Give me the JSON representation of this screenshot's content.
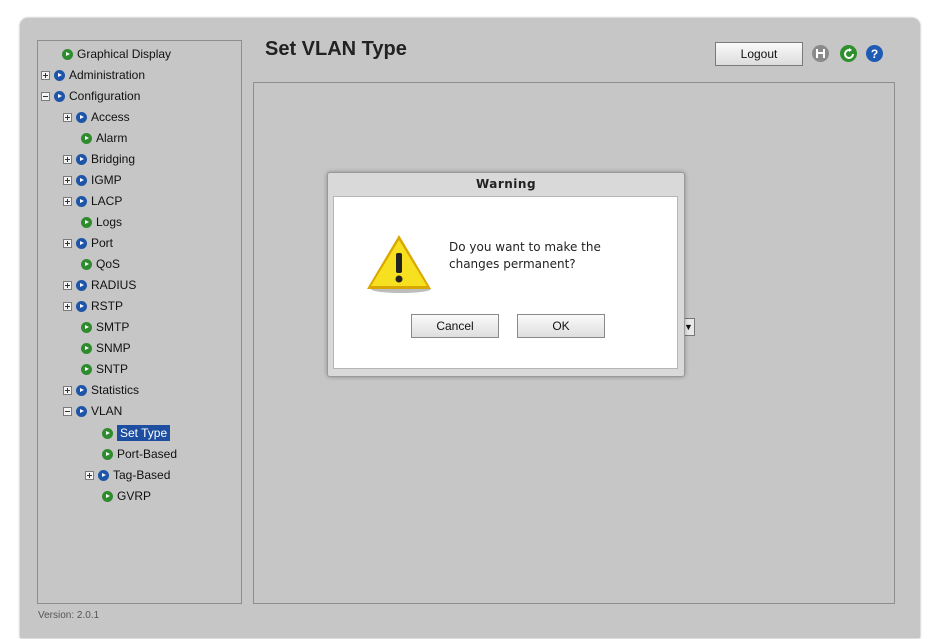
{
  "header": {
    "title": "Set VLAN Type",
    "logout_label": "Logout"
  },
  "sidebar": {
    "items": [
      {
        "label": "Graphical Display"
      },
      {
        "label": "Administration"
      },
      {
        "label": "Configuration"
      },
      {
        "label": "Access"
      },
      {
        "label": "Alarm"
      },
      {
        "label": "Bridging"
      },
      {
        "label": "IGMP"
      },
      {
        "label": "LACP"
      },
      {
        "label": "Logs"
      },
      {
        "label": "Port"
      },
      {
        "label": "QoS"
      },
      {
        "label": "RADIUS"
      },
      {
        "label": "RSTP"
      },
      {
        "label": "SMTP"
      },
      {
        "label": "SNMP"
      },
      {
        "label": "SNTP"
      },
      {
        "label": "Statistics"
      },
      {
        "label": "VLAN"
      },
      {
        "label": "Set Type"
      },
      {
        "label": "Port-Based"
      },
      {
        "label": "Tag-Based"
      },
      {
        "label": "GVRP"
      }
    ],
    "version": "Version: 2.0.1"
  },
  "dialog": {
    "title": "Warning",
    "message_line1": "Do you want to make the",
    "message_line2": "changes  permanent?",
    "cancel_label": "Cancel",
    "ok_label": "OK"
  },
  "colors": {
    "selection": "#1d4ea0",
    "bullet_green": "#2e8b2e",
    "bullet_blue": "#1e55a8",
    "panel_gray": "#c6c6c6"
  },
  "icons": [
    "save-icon",
    "refresh-icon",
    "help-icon",
    "warning-icon"
  ]
}
